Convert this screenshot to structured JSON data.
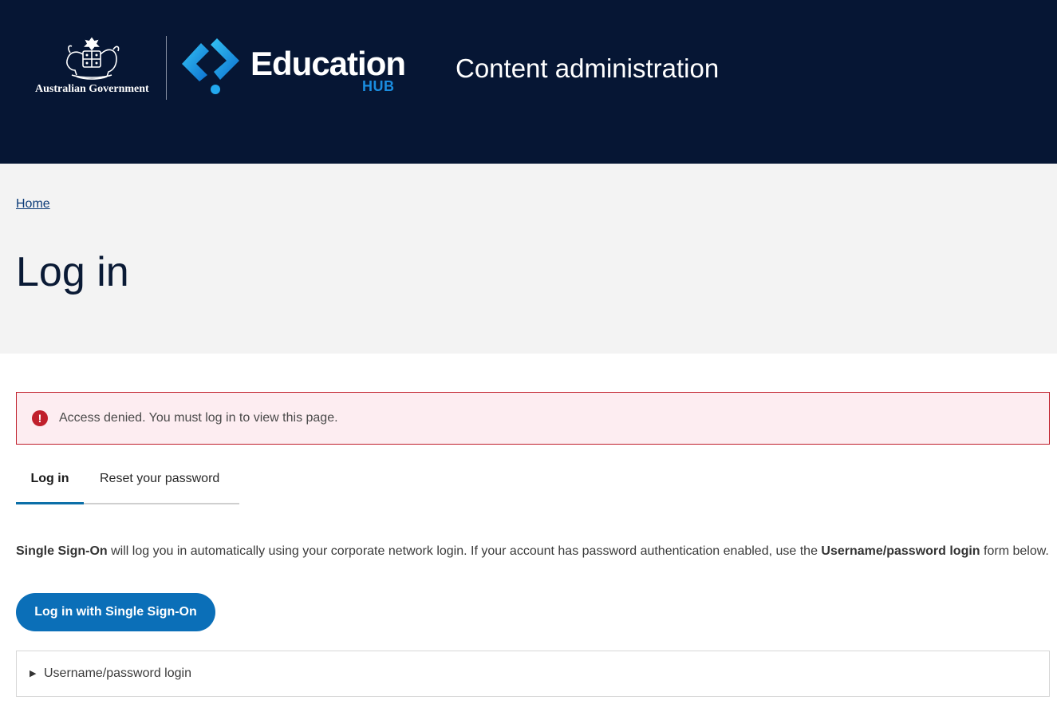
{
  "header": {
    "gov_name": "Australian Government",
    "brand_word": "Education",
    "brand_sub": "HUB",
    "site_title": "Content administration",
    "icons": [
      "coat-of-arms-icon",
      "education-hub-logo-icon"
    ],
    "colors": {
      "background": "#061634",
      "brand_blue": "#1a8de0"
    }
  },
  "breadcrumb": {
    "home": "Home"
  },
  "page": {
    "title": "Log in"
  },
  "alert": {
    "icon": "error-icon",
    "icon_glyph": "!",
    "message": "Access denied. You must log in to view this page.",
    "color": "#c0202c"
  },
  "tabs": [
    {
      "label": "Log in",
      "active": true
    },
    {
      "label": "Reset your password",
      "active": false
    }
  ],
  "intro": {
    "sso_term": "Single Sign-On",
    "text_1": " will log you in automatically using your corporate network login. If your account has password authentication enabled, use the ",
    "form_term": "Username/password login",
    "text_2": " form below."
  },
  "sso_button": {
    "label": "Log in with Single Sign-On",
    "color": "#0b6fb8"
  },
  "password_login": {
    "icon": "triangle-right-icon",
    "glyph": "▶",
    "label": "Username/password login"
  }
}
